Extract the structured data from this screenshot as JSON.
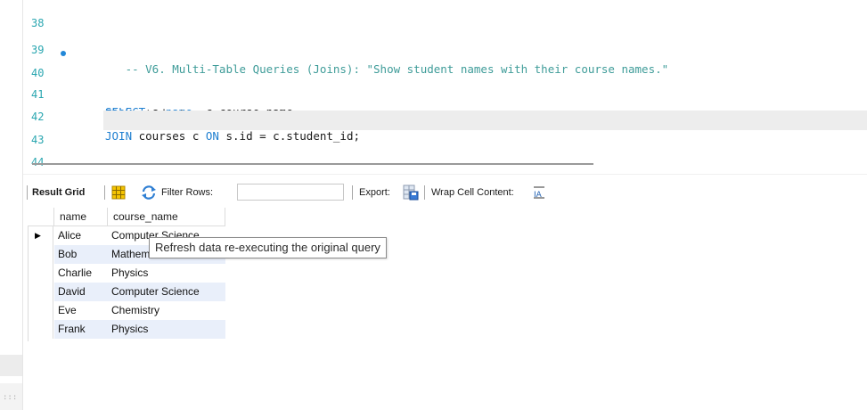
{
  "editor": {
    "lines": [
      {
        "num": "38",
        "text": ""
      },
      {
        "num": "39",
        "text": "   -- V6. Multi-Table Queries (Joins): \"Show student names with their course names.\""
      },
      {
        "num": "40",
        "text": "SELECT s.name, c.course_name",
        "marker": "•"
      },
      {
        "num": "41",
        "text": "FROM students s"
      },
      {
        "num": "42",
        "text": "JOIN courses c ON s.id = c.student_id;"
      },
      {
        "num": "43",
        "text": ""
      },
      {
        "num": "44",
        "text": ""
      }
    ]
  },
  "toolbar": {
    "result_grid_label": "Result Grid",
    "grid_view_icon": "grid-view-icon",
    "refresh_icon": "refresh-icon",
    "filter_rows_label": "Filter Rows:",
    "filter_rows_value": "",
    "export_label": "Export:",
    "export_icon": "export-icon",
    "wrap_label": "Wrap Cell Content:",
    "wrap_icon": "wrap-cell-icon"
  },
  "tooltip": {
    "text": "Refresh data re-executing the original query"
  },
  "grid": {
    "columns": [
      "name",
      "course_name"
    ],
    "rows": [
      [
        "Alice",
        "Computer Science"
      ],
      [
        "Bob",
        "Mathematics"
      ],
      [
        "Charlie",
        "Physics"
      ],
      [
        "David",
        "Computer Science"
      ],
      [
        "Eve",
        "Chemistry"
      ],
      [
        "Frank",
        "Physics"
      ]
    ],
    "current_row_marker": "▶"
  },
  "colors": {
    "line_numbers": "#2aa6b0",
    "keyword": "#1f7fd0",
    "comment": "#3f9c99",
    "alt_row": "#e9effa"
  }
}
